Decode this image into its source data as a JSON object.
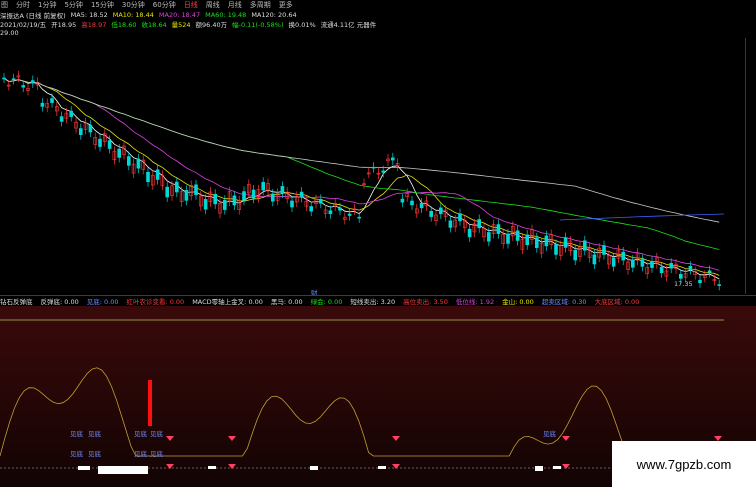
{
  "tabs": [
    "图",
    "分时",
    "1分钟",
    "5分钟",
    "15分钟",
    "30分钟",
    "60分钟",
    "日线",
    "周线",
    "月线",
    "多周期",
    "更多"
  ],
  "active_tab": "日线",
  "info_row1": {
    "stock": "深振达A (日线 前复权)",
    "ma5": "MA5: 18.52",
    "ma10": "MA10: 18.44",
    "ma20": "MA20: 18.47",
    "ma60": "MA60: 19.48",
    "ma120": "MA120: 20.64"
  },
  "info_row2": {
    "date": "2021/02/19/五",
    "open": "开18.95",
    "high": "高18.97",
    "low": "低18.60",
    "close": "收18.64",
    "vol": "量524",
    "amount": "额96.40万",
    "change": "幅-0.11(-0.58%)",
    "turnover": "换0.01%",
    "circ": "流通4.11亿 元器件"
  },
  "top_price": "29.00",
  "low_label": "17.35",
  "finance_marker": "财",
  "indicator_header": {
    "name": "钻石反弹底",
    "v1_label": "反弹底: 0.00",
    "v2_label": "见底: 0.00",
    "v3_label": "红叶农诊变看: 0.00",
    "v4_label": "MACD零轴上金叉: 0.00",
    "v5_label": "黑马: 0.00",
    "v6_label": "绿会: 0.00",
    "v7_label": "短线卖出: 3.20",
    "v8_label": "高位卖出: 3.50",
    "v9_label": "低位线: 1.92",
    "v10_label": "金山: 0.00",
    "v11_label": "超卖区域: 0.30",
    "v12_label": "大底区域: 0.00"
  },
  "jd_labels": [
    "见底",
    "见底",
    "见底",
    "见底",
    "见底",
    "见底",
    "见底",
    "见底",
    "见底"
  ],
  "watermark": "www.7gpzb.com",
  "colors": {
    "ma5": "#ffffff",
    "ma10": "#e6e600",
    "ma20": "#e040e0",
    "ma60": "#19e019",
    "ma120": "#c8c8c8",
    "ma250": "#4060ff",
    "up": "#ff3b3b",
    "down": "#00d7d7"
  }
}
